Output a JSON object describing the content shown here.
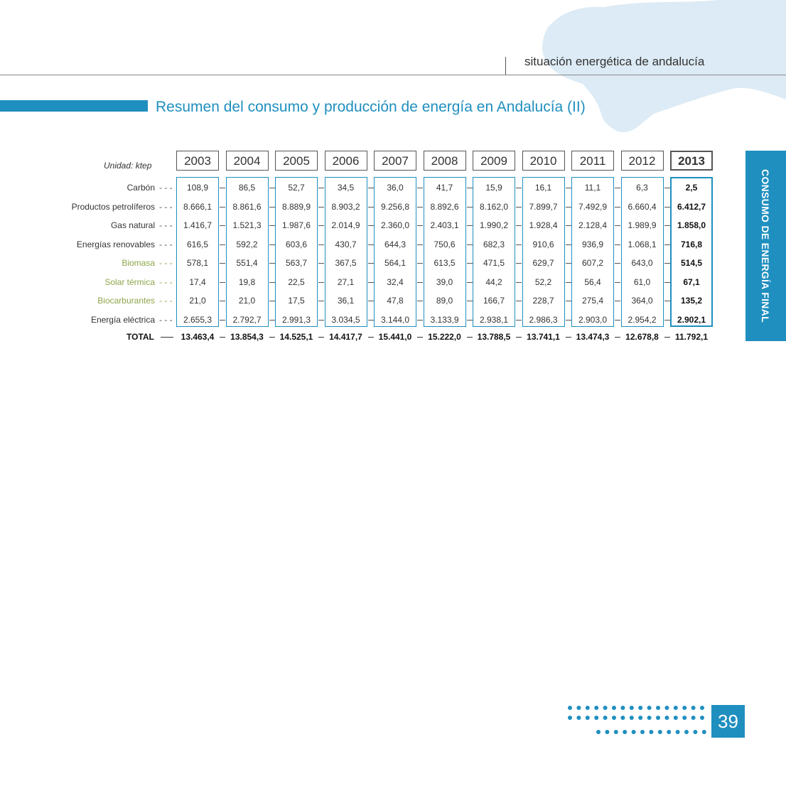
{
  "header": {
    "section": "situación energética de andalucía"
  },
  "title": "Resumen del consumo y producción de energía en Andalucía (II)",
  "side_tab": "CONSUMO DE ENERGÍA FINAL",
  "page_number": "39",
  "table": {
    "unit": "Unidad: ktep",
    "years": [
      "2003",
      "2004",
      "2005",
      "2006",
      "2007",
      "2008",
      "2009",
      "2010",
      "2011",
      "2012",
      "2013"
    ],
    "rows": [
      {
        "label": "Carbón",
        "sub": false,
        "values": [
          "108,9",
          "86,5",
          "52,7",
          "34,5",
          "36,0",
          "41,7",
          "15,9",
          "16,1",
          "11,1",
          "6,3",
          "2,5"
        ]
      },
      {
        "label": "Productos petrolíferos",
        "sub": false,
        "values": [
          "8.666,1",
          "8.861,6",
          "8.889,9",
          "8.903,2",
          "9.256,8",
          "8.892,6",
          "8.162,0",
          "7.899,7",
          "7.492,9",
          "6.660,4",
          "6.412,7"
        ]
      },
      {
        "label": "Gas natural",
        "sub": false,
        "values": [
          "1.416,7",
          "1.521,3",
          "1.987,6",
          "2.014,9",
          "2.360,0",
          "2.403,1",
          "1.990,2",
          "1.928,4",
          "2.128,4",
          "1.989,9",
          "1.858,0"
        ]
      },
      {
        "label": "Energías renovables",
        "sub": false,
        "values": [
          "616,5",
          "592,2",
          "603,6",
          "430,7",
          "644,3",
          "750,6",
          "682,3",
          "910,6",
          "936,9",
          "1.068,1",
          "716,8"
        ]
      },
      {
        "label": "Biomasa",
        "sub": true,
        "values": [
          "578,1",
          "551,4",
          "563,7",
          "367,5",
          "564,1",
          "613,5",
          "471,5",
          "629,7",
          "607,2",
          "643,0",
          "514,5"
        ]
      },
      {
        "label": "Solar térmica",
        "sub": true,
        "values": [
          "17,4",
          "19,8",
          "22,5",
          "27,1",
          "32,4",
          "39,0",
          "44,2",
          "52,2",
          "56,4",
          "61,0",
          "67,1"
        ]
      },
      {
        "label": "Biocarburantes",
        "sub": true,
        "values": [
          "21,0",
          "21,0",
          "17,5",
          "36,1",
          "47,8",
          "89,0",
          "166,7",
          "228,7",
          "275,4",
          "364,0",
          "135,2"
        ]
      },
      {
        "label": "Energía eléctrica",
        "sub": false,
        "values": [
          "2.655,3",
          "2.792,7",
          "2.991,3",
          "3.034,5",
          "3.144,0",
          "3.133,9",
          "2.938,1",
          "2.986,3",
          "2.903,0",
          "2.954,2",
          "2.902,1"
        ]
      }
    ],
    "total": {
      "label": "TOTAL",
      "values": [
        "13.463,4",
        "13.854,3",
        "14.525,1",
        "14.417,7",
        "15.441,0",
        "15.222,0",
        "13.788,5",
        "13.741,1",
        "13.474,3",
        "12.678,8",
        "11.792,1"
      ]
    }
  },
  "colors": {
    "accent": "#1f8fbf",
    "green": "#8da64a",
    "map": "#dcebf5"
  }
}
